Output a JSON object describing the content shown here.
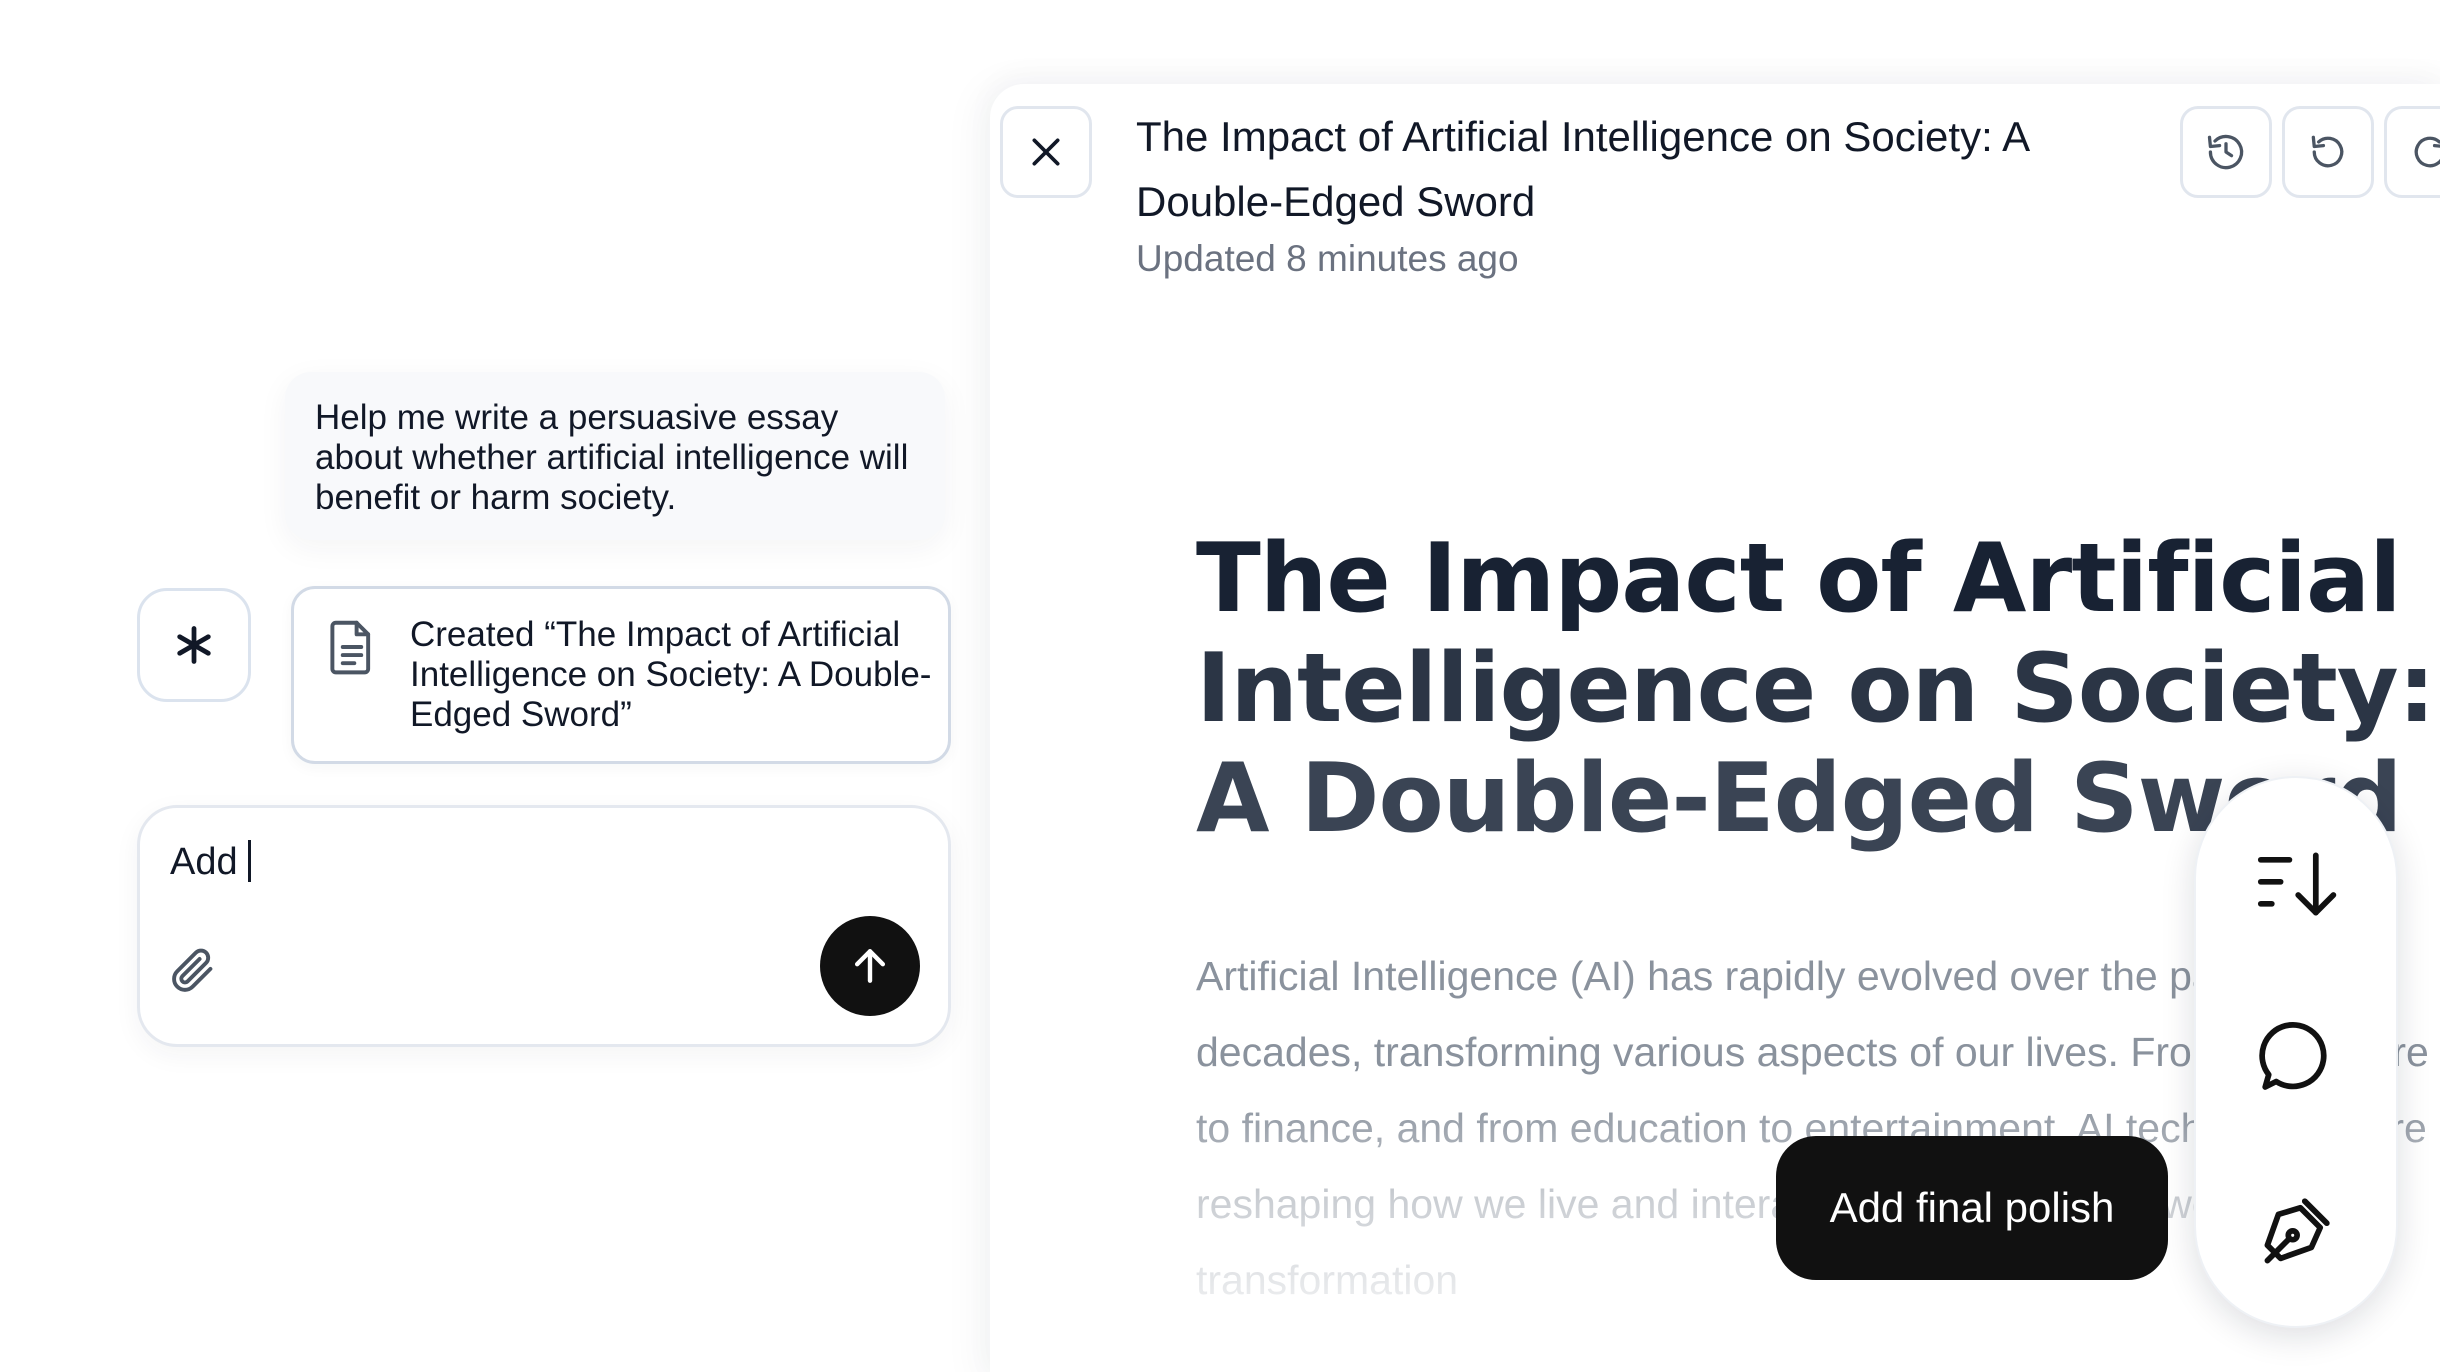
{
  "chat": {
    "user_message": "Help me write a persuasive essay about whether artificial intelligence will benefit or harm society.",
    "artifact_card_text": "Created “The Impact of Artificial Intelligence on Society: A Double-Edged Sword”",
    "composer_value": "Add",
    "icons": {
      "assistant": "asterisk-icon",
      "artifact": "document-icon",
      "attach": "paperclip-icon",
      "send": "arrow-up-icon"
    }
  },
  "document": {
    "header_title": "The Impact of Artificial Intelligence on Society: A Double-Edged Sword",
    "updated": "Updated 8 minutes ago",
    "title_line1": "The Impact of Artificial",
    "title_line2": "Intelligence on Society:",
    "title_line3": "A Double-Edged Sword",
    "paragraph": "Artificial Intelligence (AI) has rapidly evolved over the past few decades, transforming various aspects of our lives. From healthcare to finance, and from education to entertainment, AI technologies are reshaping how we live and interact with the world. However, this transformation",
    "icons": {
      "close": "close-icon",
      "history": "history-icon",
      "undo": "undo-icon",
      "redo": "redo-icon"
    }
  },
  "floating_toolbar": {
    "tooltip": "Add final polish",
    "icons": [
      "adjust-length-icon",
      "comment-icon",
      "pen-icon"
    ]
  },
  "colors": {
    "send_button": "#111111",
    "tooltip_bg": "#111111",
    "heading": "#182233",
    "muted_text": "#8a929d"
  }
}
